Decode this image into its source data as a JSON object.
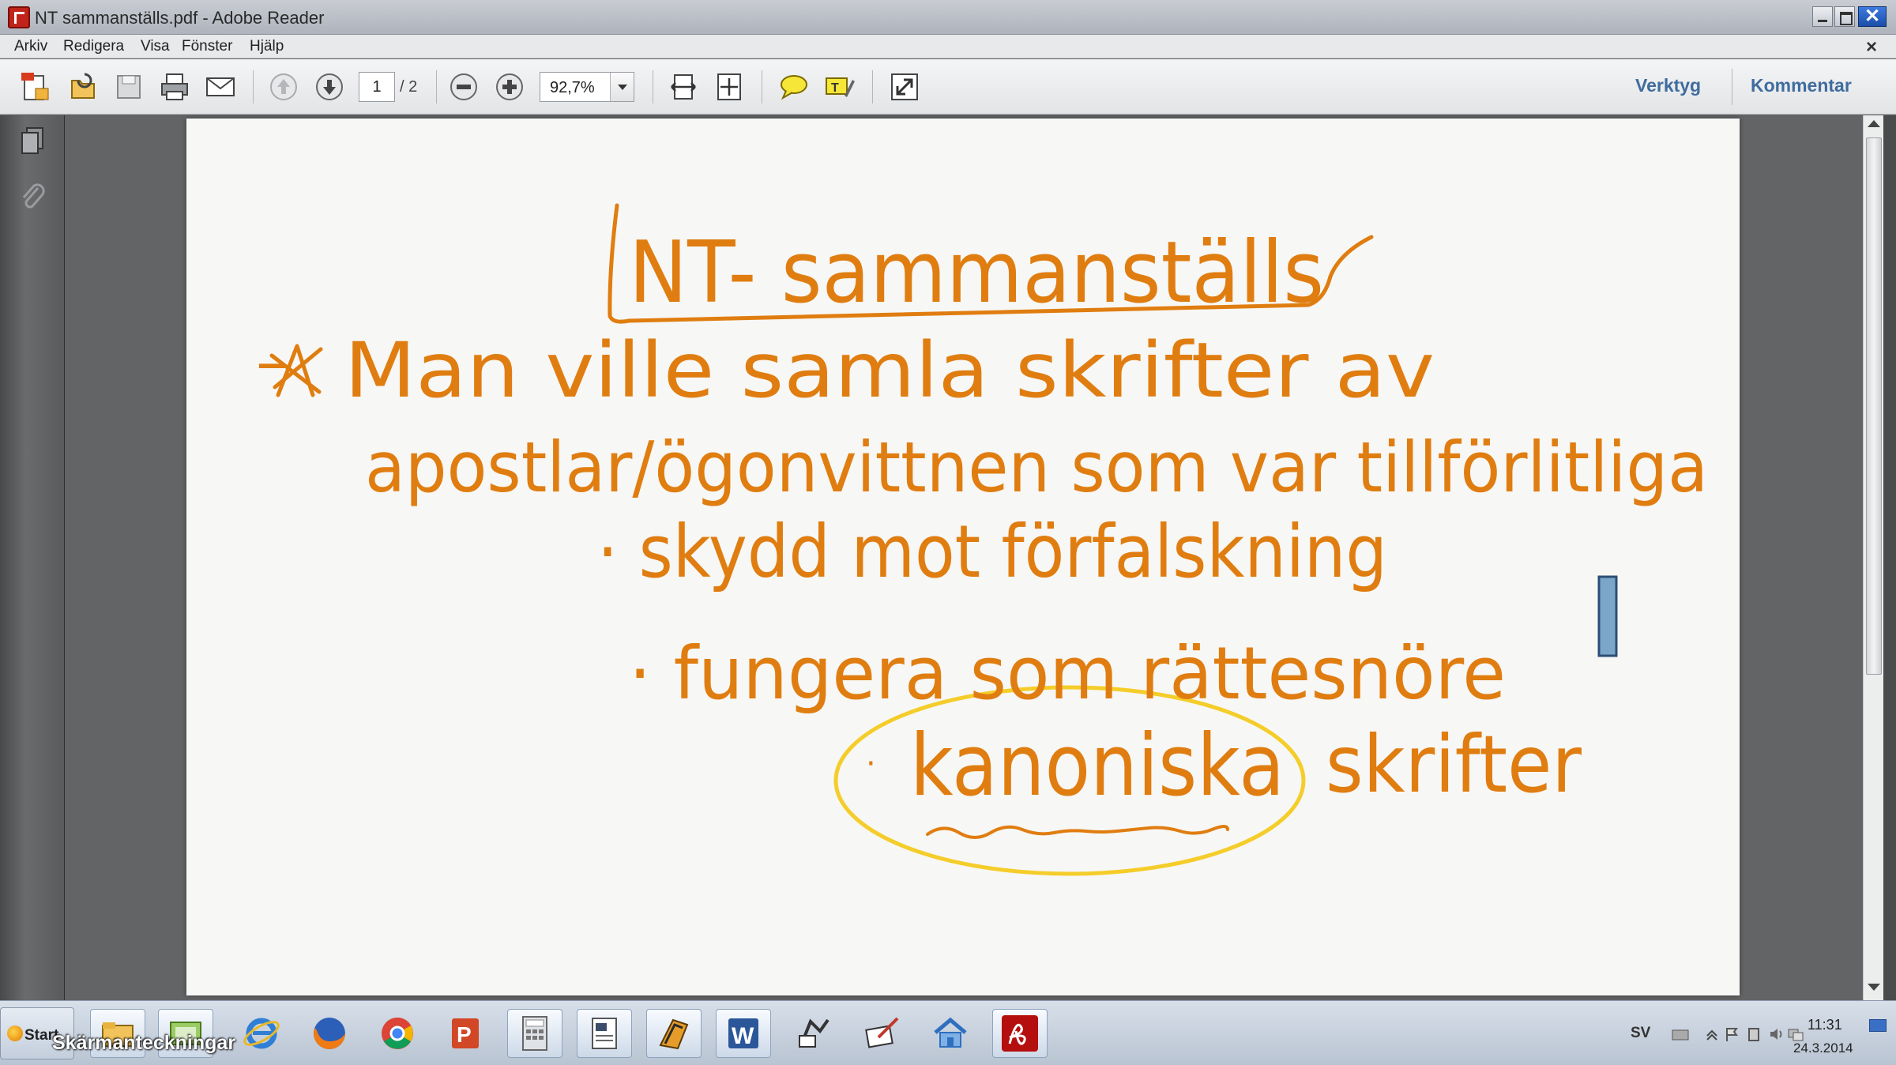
{
  "window": {
    "title": "NT sammanställs.pdf - Adobe Reader",
    "close_symbol": "✕"
  },
  "menu": {
    "items": [
      "Arkiv",
      "Redigera",
      "Visa",
      "Fönster",
      "Hjälp"
    ],
    "doc_close": "×"
  },
  "toolbar": {
    "page_current": "1",
    "page_total": "/ 2",
    "zoom": "92,7%",
    "tools_label": "Verktyg",
    "comment_label": "Kommentar"
  },
  "document": {
    "ink_color": "#e07d10",
    "highlight_color": "#f5cd2a",
    "title": "NT- sammanställs",
    "bullet_dash": "–",
    "line1": "Man ville samla skrifter av",
    "line2": "apostlar/ögonvittnen som var tillförlitliga",
    "line3": "· skydd mot förfalskning",
    "line4": "· fungera som rättesnöre",
    "line5_highlight": "kanoniska",
    "line5_rest": "skrifter",
    "dot_mark": "·"
  },
  "taskbar": {
    "start_label": "Start",
    "overlay_label": "Skärmanteckningar",
    "apps": [
      "file-explorer-icon",
      "media-icon",
      "internet-explorer-icon",
      "firefox-icon",
      "chrome-icon",
      "powerpoint-icon",
      "calculator-icon",
      "notepad-icon",
      "smart-board-icon",
      "word-icon",
      "smart-tools-icon",
      "smart-notebook-icon",
      "home-icon",
      "adobe-reader-icon"
    ],
    "tray_language": "SV",
    "clock_time": "11:31",
    "clock_date": "24.3.2014"
  }
}
